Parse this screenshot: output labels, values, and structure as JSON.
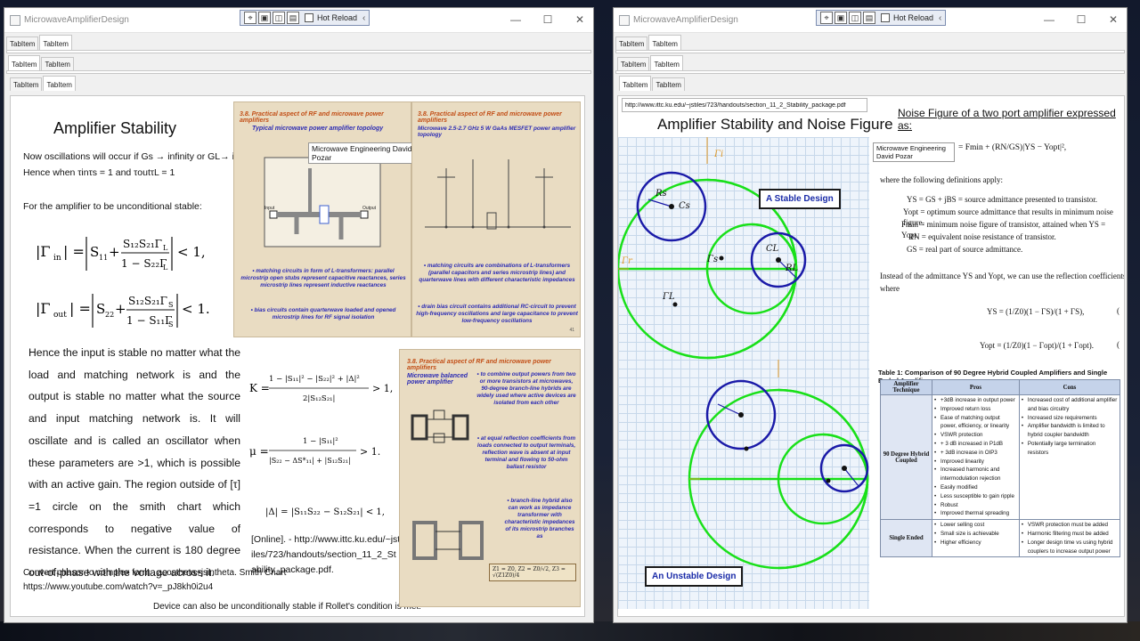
{
  "left_window": {
    "title": "MicrowaveAmplifierDesign",
    "toolbar": {
      "hot_reload": "Hot Reload"
    },
    "tab_rows": [
      [
        "TabItem",
        "TabItem"
      ],
      [
        "TabItem",
        "TabItem"
      ],
      [
        "TabItem",
        "TabItem"
      ]
    ],
    "content": {
      "title": "Amplifier Stability",
      "line1": "Now oscillations will occur if Gs → infinity or GL→ infinity.",
      "line2": "Hence when τinτs = 1 and τoutτL = 1",
      "condition": "For the amplifier to be unconditional stable:",
      "eq_gamma_in": "|Γin| = | S11 + S12S21ΓL / (1 − S22ΓL) | < 1,",
      "eq_gamma_out": "|Γout| = | S22 + S12S21ΓS / (1 − S11ΓS) | < 1.",
      "paragraph": "Hence the input is stable no matter what the load and matching network is and the output is stable no matter what the source and input matching network is. It will oscillate and is called an oscillator when these parameters are >1, which is possible with an active gain. The region outside of [τ] =1 circle on the smith chart which corresponds to negative value of resistance. When the current is 180 degree out-of-phase with the voltage across it.",
      "eq_K": "K = (1 − |S11|² − |S22|² + |Δ|²) / (2|S12S21|) > 1,",
      "eq_mu": "μ = (1 − |S11|²) / (|S22 − ΔS*11| + |S12S21|) > 1.",
      "eq_delta": "|Δ| = |S11S22 − S12S21| < 1,",
      "reference": "[Online]. - http://www.ittc.ku.edu/~jstiles/723/handouts/section_11_2_Stability_package.pdf.",
      "footer1": "Convert phasor to complex form : acostheta+jsintheta. Smith Chart",
      "footer2": "https://www.youtube.com/watch?v=_pJ8kh0i2u4",
      "footer3": "Device can also be unconditionally stable if Rollet's condition is met:",
      "overlay_label": "Microwave Engineering David Pozar"
    },
    "slides": [
      {
        "heading": "3.8. Practical aspect of RF and microwave power amplifiers",
        "subtitle": "Typical microwave power amplifier topology",
        "bullets": [
          "• matching circuits in form of L-transformers: parallel microstrip open stubs represent capacitive reactances, series microstrip lines represent inductive reactances",
          "• bias circuits contain quarterwave loaded and opened microstrip lines for RF signal isolation"
        ],
        "labels": {
          "input": "Input",
          "output": "Output"
        }
      },
      {
        "heading": "3.8. Practical aspect of RF and microwave power amplifiers",
        "subtitle": "Microwave 2.5-2.7 GHz 5 W GaAs MESFET power amplifier topology",
        "bullets": [
          "• matching circuits are combinations of L-transformers (parallel capacitors and series microstrip lines) and quarterwave lines with different characteristic impedances",
          "• drain bias circuit contains additional RC-circuit to prevent high-frequency oscillations and large capacitance to prevent low-frequency oscillations"
        ],
        "page": "41"
      },
      {
        "heading": "3.8. Practical aspect of RF and microwave power amplifiers",
        "subtitle": "Microwave balanced power amplifier",
        "bullets": [
          "• to combine output powers from two or more transistors at microwaves, 90-degree branch-line hybrids are widely used where active devices are isolated from each other",
          "• at equal reflection coefficients from loads connected to output terminals, reflection wave is absent at input terminal and flowing to 50-ohm ballast resistor",
          "• branch-line hybrid also can work as impedance transformer with characteristic impedances of its microstrip branches as"
        ],
        "formula": "Z1 = Z0,  Z2 = Z0/√2,  Z3 = √(Z1Z0)/4"
      }
    ]
  },
  "right_window": {
    "title": "MicrowaveAmplifierDesign",
    "toolbar": {
      "hot_reload": "Hot Reload"
    },
    "tab_rows": [
      [
        "TabItem",
        "TabItem"
      ],
      [
        "TabItem",
        "TabItem"
      ],
      [
        "TabItem",
        "TabItem"
      ]
    ],
    "content": {
      "url": "http://www.ittc.ku.edu/~jstiles/723/handouts/section_11_2_Stability_package.pdf",
      "title": "Amplifier Stability and Noise Figure",
      "stable_badge": "A Stable Design",
      "unstable_badge": "An Unstable Design",
      "noise_title": "Noise Figure of a two port amplifier expressed as:",
      "overlay_label": "Microwave Engineering David Pozar",
      "noise_eq": "= Fmin + (RN/GS)|YS − Yopt|²,",
      "defs_intro": "where the following definitions apply:",
      "defs": [
        "YS = GS + jBS = source admittance presented to transistor.",
        "Yopt = optimum source admittance that results in minimum noise figure.",
        "Fmin = minimum noise figure of transistor, attained when YS = Yopt.",
        "RN = equivalent noise resistance of transistor.",
        "GS = real part of source admittance."
      ],
      "instead": "Instead of the admittance YS and Yopt, we can use the reflection coefficients ΓS and",
      "where": "where",
      "eq_ys": "YS = (1/Z0)(1 − ΓS)/(1 + ΓS),",
      "eq_yopt": "Yopt = (1/Z0)(1 − Γopt)/(1 + Γopt).",
      "eq_num_1": "(",
      "eq_num_2": "(",
      "table_title": "Table 1: Comparison of 90 Degree Hybrid Coupled Amplifiers and Single Ended Amplifiers",
      "table": {
        "headers": [
          "Amplifier Technique",
          "Pros",
          "Cons"
        ],
        "rows": [
          {
            "technique": "90 Degree Hybrid Coupled",
            "pros": [
              "+3dB increase in output power",
              "Improved return loss",
              "Ease of matching output power, efficiency, or linearity",
              "VSWR protection",
              "+ 3 dB increased in P1dB",
              "+ 3dB increase in OIP3",
              "Improved linearity",
              "Increased harmonic and intermodulation rejection",
              "Easily modified",
              "Less susceptible to gain ripple",
              "Robust",
              "Improved thermal spreading"
            ],
            "cons": [
              "Increased cost of additional amplifier and bias circuitry",
              "Increased size requirements",
              "Amplifier bandwidth is limited to hybrid coupler bandwidth",
              "Potentially large termination resistors"
            ]
          },
          {
            "technique": "Single Ended",
            "pros": [
              "Lower selling cost",
              "Small size is achievable",
              "Higher efficiency"
            ],
            "cons": [
              "VSWR protection must be added",
              "Harmonic filtering must be added",
              "Longer design time vs using hybrid couplers to increase output power"
            ]
          }
        ]
      },
      "smith_labels": {
        "r_s": "Rs",
        "c_s": "Cs",
        "gamma_s": "Γs",
        "gamma_l": "ΓL",
        "c_l": "CL",
        "r_l": "RL",
        "gamma_i": "Γi",
        "gamma_r": "Γr"
      }
    }
  },
  "colors": {
    "smith_green": "#19e019",
    "stability_blue": "#1a1aa8",
    "slide_bg": "#e9dcc2",
    "slide_heading": "#c24e16",
    "slide_text": "#2b2bb4"
  }
}
